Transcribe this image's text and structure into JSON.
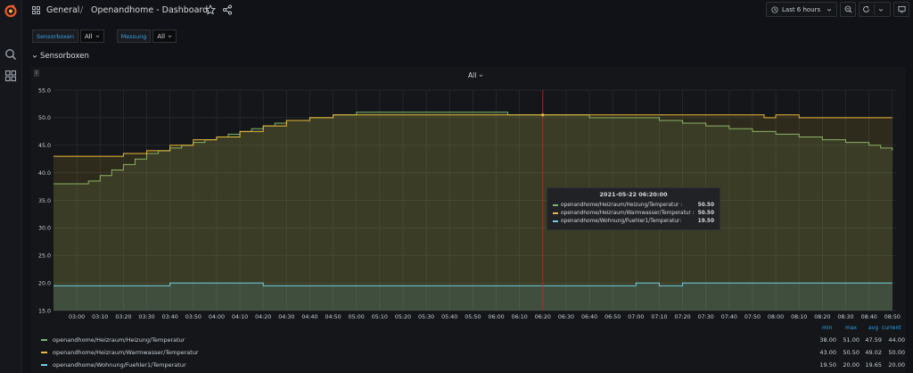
{
  "header": {
    "folder": "General",
    "separator": "/",
    "title": "Openandhome - Dashboard",
    "time_range": "Last 6 hours"
  },
  "variables": [
    {
      "label": "Sensorboxen",
      "value": "All"
    },
    {
      "label": "Messung",
      "value": "All"
    }
  ],
  "row": {
    "title": "Sensorboxen"
  },
  "panel": {
    "title": "All",
    "info": "i"
  },
  "colors": {
    "heizung": "#7eb26d",
    "warmwasser": "#eab839",
    "fuehler": "#6ed0e0",
    "accent": "#33a2e5",
    "crosshair": "#b03030"
  },
  "tooltip": {
    "time": "2021-05-22 06:20:00",
    "rows": [
      {
        "name": "openandhome/Heizraum/Heizung/Temperatur :",
        "value": "50.50"
      },
      {
        "name": "openandhome/Heizraum/Warmwasser/Temperatur :",
        "value": "50.50"
      },
      {
        "name": "openandhome/Wohnung/Fuehler1/Temperatur:",
        "value": "19.50"
      }
    ]
  },
  "legend": {
    "headers": {
      "min": "min",
      "max": "max",
      "avg": "avg",
      "current": "current"
    },
    "rows": [
      {
        "name": "openandhome/Heizraum/Heizung/Temperatur",
        "min": "38.00",
        "max": "51.00",
        "avg": "47.59",
        "current": "44.00"
      },
      {
        "name": "openandhome/Heizraum/Warmwasser/Temperatur",
        "min": "43.00",
        "max": "50.50",
        "avg": "49.02",
        "current": "50.00"
      },
      {
        "name": "openandhome/Wohnung/Fuehler1/Temperatur",
        "min": "19.50",
        "max": "20.00",
        "avg": "19.65",
        "current": "20.00"
      }
    ]
  },
  "chart_data": {
    "type": "area",
    "title": "All",
    "y_ticks": [
      "15.0",
      "20.0",
      "25.0",
      "30.0",
      "35.0",
      "40.0",
      "45.0",
      "50.0",
      "55.0"
    ],
    "ylim": [
      15,
      55
    ],
    "x_ticks": [
      "03:00",
      "03:10",
      "03:20",
      "03:30",
      "03:40",
      "03:50",
      "04:00",
      "04:10",
      "04:20",
      "04:30",
      "04:40",
      "04:50",
      "05:00",
      "05:10",
      "05:20",
      "05:30",
      "05:40",
      "05:50",
      "06:00",
      "06:10",
      "06:20",
      "06:30",
      "06:40",
      "06:50",
      "07:00",
      "07:10",
      "07:20",
      "07:30",
      "07:40",
      "07:50",
      "08:00",
      "08:10",
      "08:20",
      "08:30",
      "08:40",
      "08:50"
    ],
    "x_start": "02:50",
    "x_end": "08:52",
    "grid": true,
    "crosshair": "06:20",
    "series": [
      {
        "name": "openandhome/Heizraum/Heizung/Temperatur",
        "color": "#7eb26d",
        "points": [
          [
            "02:50",
            38.0
          ],
          [
            "03:00",
            38.0
          ],
          [
            "03:05",
            38.5
          ],
          [
            "03:10",
            39.5
          ],
          [
            "03:15",
            40.5
          ],
          [
            "03:20",
            41.5
          ],
          [
            "03:25",
            42.5
          ],
          [
            "03:30",
            43.5
          ],
          [
            "03:35",
            44.0
          ],
          [
            "03:40",
            44.5
          ],
          [
            "03:45",
            45.0
          ],
          [
            "03:50",
            45.5
          ],
          [
            "03:55",
            46.0
          ],
          [
            "04:00",
            46.5
          ],
          [
            "04:05",
            47.0
          ],
          [
            "04:10",
            47.5
          ],
          [
            "04:15",
            48.0
          ],
          [
            "04:20",
            48.5
          ],
          [
            "04:25",
            49.0
          ],
          [
            "04:30",
            49.5
          ],
          [
            "04:35",
            49.5
          ],
          [
            "04:40",
            50.0
          ],
          [
            "04:50",
            50.5
          ],
          [
            "05:00",
            51.0
          ],
          [
            "05:30",
            51.0
          ],
          [
            "06:00",
            51.0
          ],
          [
            "06:05",
            50.5
          ],
          [
            "06:20",
            50.5
          ],
          [
            "06:30",
            50.5
          ],
          [
            "06:40",
            50.0
          ],
          [
            "07:00",
            50.0
          ],
          [
            "07:10",
            49.5
          ],
          [
            "07:20",
            49.0
          ],
          [
            "07:30",
            48.5
          ],
          [
            "07:40",
            48.0
          ],
          [
            "07:50",
            47.5
          ],
          [
            "08:00",
            47.0
          ],
          [
            "08:10",
            46.5
          ],
          [
            "08:20",
            46.0
          ],
          [
            "08:30",
            45.5
          ],
          [
            "08:40",
            45.0
          ],
          [
            "08:45",
            44.5
          ],
          [
            "08:50",
            44.0
          ]
        ]
      },
      {
        "name": "openandhome/Heizraum/Warmwasser/Temperatur",
        "color": "#eab839",
        "points": [
          [
            "02:50",
            43.0
          ],
          [
            "03:10",
            43.0
          ],
          [
            "03:20",
            43.5
          ],
          [
            "03:30",
            44.0
          ],
          [
            "03:40",
            45.0
          ],
          [
            "03:50",
            46.0
          ],
          [
            "04:00",
            46.5
          ],
          [
            "04:10",
            47.5
          ],
          [
            "04:20",
            48.5
          ],
          [
            "04:30",
            49.5
          ],
          [
            "04:40",
            50.0
          ],
          [
            "04:50",
            50.5
          ],
          [
            "05:30",
            50.5
          ],
          [
            "06:00",
            50.5
          ],
          [
            "06:20",
            50.5
          ],
          [
            "06:30",
            50.5
          ],
          [
            "07:30",
            50.5
          ],
          [
            "07:50",
            50.5
          ],
          [
            "07:55",
            50.0
          ],
          [
            "08:00",
            50.5
          ],
          [
            "08:10",
            50.0
          ],
          [
            "08:50",
            50.0
          ]
        ]
      },
      {
        "name": "openandhome/Wohnung/Fuehler1/Temperatur",
        "color": "#6ed0e0",
        "points": [
          [
            "02:50",
            19.5
          ],
          [
            "03:30",
            19.5
          ],
          [
            "03:40",
            20.0
          ],
          [
            "04:10",
            20.0
          ],
          [
            "04:20",
            19.5
          ],
          [
            "06:50",
            19.5
          ],
          [
            "07:00",
            20.0
          ],
          [
            "07:10",
            19.5
          ],
          [
            "07:20",
            20.0
          ],
          [
            "08:20",
            20.0
          ],
          [
            "08:50",
            20.0
          ]
        ]
      }
    ]
  }
}
